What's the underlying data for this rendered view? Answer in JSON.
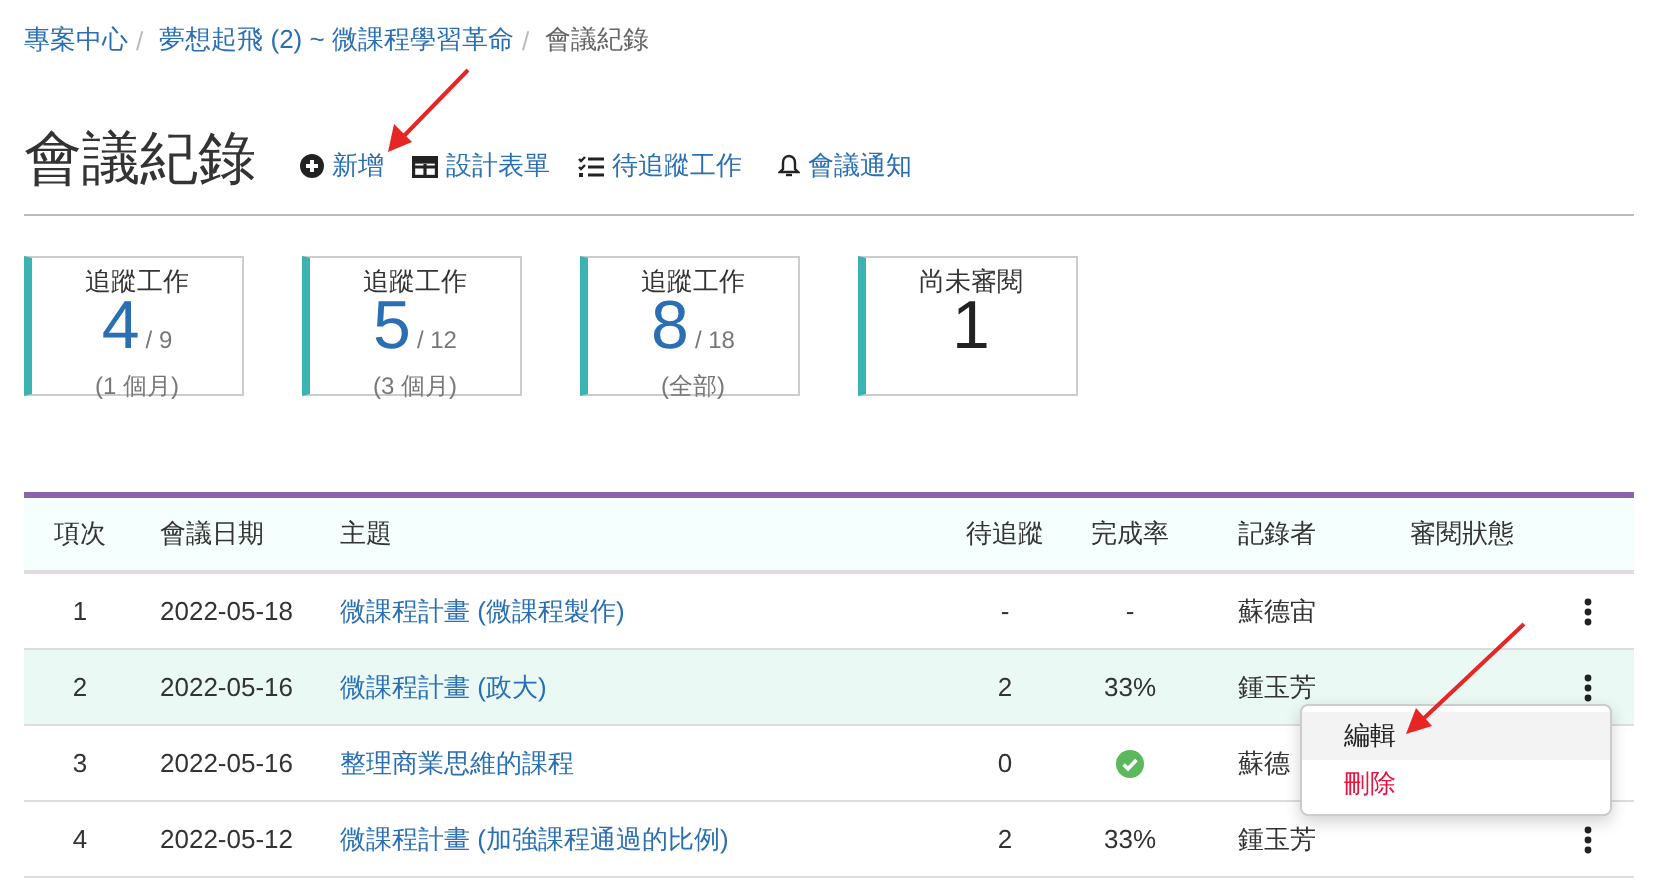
{
  "breadcrumb_separator": "/",
  "breadcrumb": [
    {
      "label": "專案中心",
      "current": false
    },
    {
      "label": "夢想起飛 (2) ~ 微課程學習革命",
      "current": false
    },
    {
      "label": "會議紀錄",
      "current": true
    }
  ],
  "page": {
    "title": "會議紀錄",
    "actions": [
      {
        "kind": "add",
        "label": "新增"
      },
      {
        "kind": "form",
        "label": "設計表單"
      },
      {
        "kind": "todo",
        "label": "待追蹤工作"
      },
      {
        "kind": "notify",
        "label": "會議通知"
      }
    ]
  },
  "cards": [
    {
      "title": "追蹤工作",
      "value": "4",
      "total": "/ 9",
      "note": "(1 個月)"
    },
    {
      "title": "追蹤工作",
      "value": "5",
      "total": "/ 12",
      "note": "(3 個月)"
    },
    {
      "title": "追蹤工作",
      "value": "8",
      "total": "/ 18",
      "note": "(全部)"
    },
    {
      "title": "尚未審閱",
      "value": "1"
    }
  ],
  "table": {
    "columns": [
      "項次",
      "會議日期",
      "主題",
      "待追蹤",
      "完成率",
      "記錄者",
      "審閱狀態"
    ],
    "rows": [
      {
        "no": "1",
        "date": "2022-05-18",
        "topic": "微課程計畫 (微課程製作)",
        "pending": "-",
        "completion": {
          "kind": "text",
          "text": "-"
        },
        "recorder": "蘇德宙",
        "highlighted": false
      },
      {
        "no": "2",
        "date": "2022-05-16",
        "topic": "微課程計畫 (政大)",
        "pending": "2",
        "completion": {
          "kind": "text",
          "text": "33%"
        },
        "recorder": "鍾玉芳",
        "highlighted": true
      },
      {
        "no": "3",
        "date": "2022-05-16",
        "topic": "整理商業思維的課程",
        "pending": "0",
        "completion": {
          "kind": "check"
        },
        "recorder": "蘇德",
        "highlighted": false
      },
      {
        "no": "4",
        "date": "2022-05-12",
        "topic": "微課程計畫 (加強課程通過的比例)",
        "pending": "2",
        "completion": {
          "kind": "text",
          "text": "33%"
        },
        "recorder": "鍾玉芳",
        "highlighted": false
      }
    ]
  },
  "row_menu": {
    "items": [
      {
        "kind": "normal",
        "label": "編輯",
        "hovered": true
      },
      {
        "kind": "danger",
        "label": "刪除",
        "hovered": false
      }
    ]
  }
}
